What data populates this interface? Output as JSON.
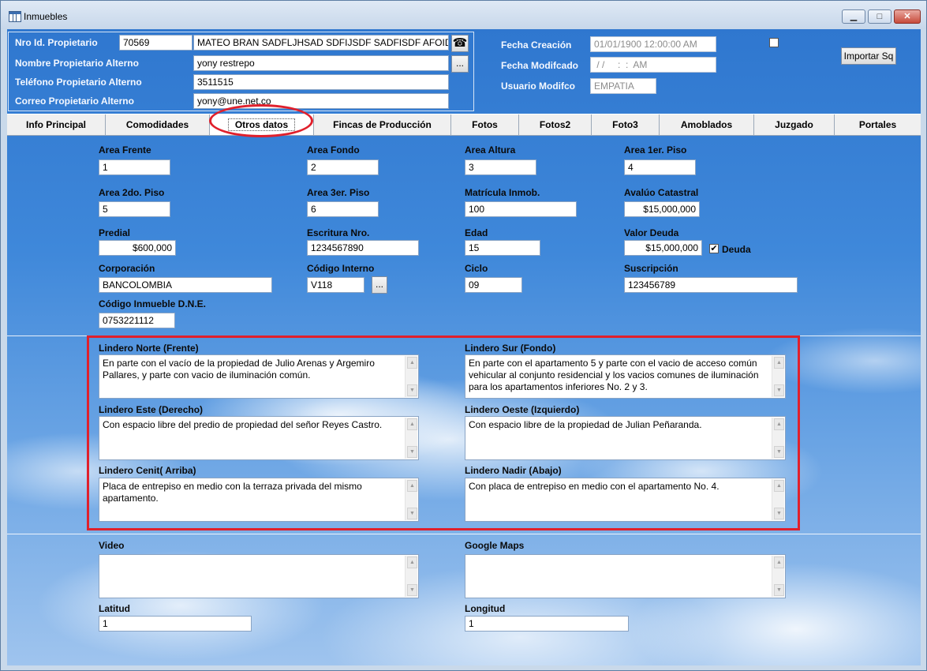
{
  "window": {
    "title": "Inmuebles",
    "min": "▁",
    "max": "□",
    "close": "✕"
  },
  "header": {
    "owner_id_label": "Nro Id. Propietario",
    "owner_id": "70569",
    "owner_name": "MATEO BRAN SADFLJHSAD SDFIJSDF SADFISDF AFOID",
    "alt_name_label": "Nombre Propietario Alterno",
    "alt_name": "yony restrepo",
    "alt_phone_label": "Teléfono Propietario Alterno",
    "alt_phone": "3511515",
    "alt_email_label": "Correo Propietario Alterno",
    "alt_email": "yony@une.net.co",
    "ellipsis": "...",
    "phone_icon": "☎",
    "created_label": "Fecha Creación",
    "created_value": "01/01/1900 12:00:00 AM",
    "modified_label": "Fecha Modifcado",
    "modified_value": " / /     :  :  AM",
    "user_label": "Usuario Modifco",
    "user_value": "EMPATIA",
    "import_button": "Importar Sq"
  },
  "tabs": [
    {
      "label": "Info Principal"
    },
    {
      "label": "Comodidades"
    },
    {
      "label": "Otros datos",
      "active": true
    },
    {
      "label": "Fincas de Producción"
    },
    {
      "label": "Fotos"
    },
    {
      "label": "Fotos2"
    },
    {
      "label": "Foto3"
    },
    {
      "label": "Amoblados"
    },
    {
      "label": "Juzgado"
    },
    {
      "label": "Portales"
    }
  ],
  "fields": {
    "area_frente": {
      "label": "Area Frente",
      "value": "1"
    },
    "area_fondo": {
      "label": "Area Fondo",
      "value": "2"
    },
    "area_altura": {
      "label": "Area Altura",
      "value": "3"
    },
    "area_1er_piso": {
      "label": "Area 1er. Piso",
      "value": "4"
    },
    "area_2do_piso": {
      "label": "Area 2do. Piso",
      "value": "5"
    },
    "area_3er_piso": {
      "label": "Area 3er. Piso",
      "value": "6"
    },
    "matricula": {
      "label": "Matrícula Inmob.",
      "value": "100"
    },
    "avaluo": {
      "label": "Avalúo Catastral",
      "value": "$15,000,000"
    },
    "predial": {
      "label": "Predial",
      "value": "$600,000"
    },
    "escritura": {
      "label": "Escritura Nro.",
      "value": "1234567890"
    },
    "edad": {
      "label": "Edad",
      "value": "15"
    },
    "valor_deuda": {
      "label": "Valor Deuda",
      "value": "$15,000,000"
    },
    "deuda_check": {
      "label": "Deuda",
      "checked": "✔"
    },
    "corporacion": {
      "label": "Corporación",
      "value": "BANCOLOMBIA"
    },
    "codigo_interno": {
      "label": "Código Interno",
      "value": "V118"
    },
    "ciclo": {
      "label": "Ciclo",
      "value": "09"
    },
    "suscripcion": {
      "label": "Suscripción",
      "value": "123456789"
    },
    "codigo_dne": {
      "label": "Código Inmueble D.N.E.",
      "value": "0753221112"
    }
  },
  "linderos": {
    "norte": {
      "label": "Lindero Norte (Frente)",
      "text": "En parte con el vacío de la propiedad de Julio Arenas y Argemiro Pallares, y parte con vacio de iluminación común."
    },
    "sur": {
      "label": "Lindero Sur (Fondo)",
      "text": "En parte con el apartamento 5 y parte con el vacio de acceso común vehicular al conjunto residencial y los vacios comunes de iluminación para los apartamentos inferiores No. 2 y 3."
    },
    "este": {
      "label": "Lindero Este (Derecho)",
      "text": "Con  espacio libre del predio de propiedad del señor Reyes Castro."
    },
    "oeste": {
      "label": "Lindero Oeste (Izquierdo)",
      "text": "Con espacio libre de la propiedad de Julian Peñaranda."
    },
    "cenit": {
      "label": "Lindero Cenit( Arriba)",
      "text": "Placa de entrepiso en medio con la terraza privada del mismo apartamento."
    },
    "nadir": {
      "label": "Lindero Nadir (Abajo)",
      "text": "Con placa de entrepiso en medio con el apartamento No. 4."
    }
  },
  "media": {
    "video": {
      "label": "Video",
      "text": ""
    },
    "maps": {
      "label": "Google Maps",
      "text": ""
    },
    "latitud": {
      "label": "Latitud",
      "value": "1"
    },
    "longitud": {
      "label": "Longitud",
      "value": "1"
    }
  },
  "scroll_glyphs": {
    "up": "▲",
    "down": "▼"
  },
  "annotation_color": "#e0202c"
}
